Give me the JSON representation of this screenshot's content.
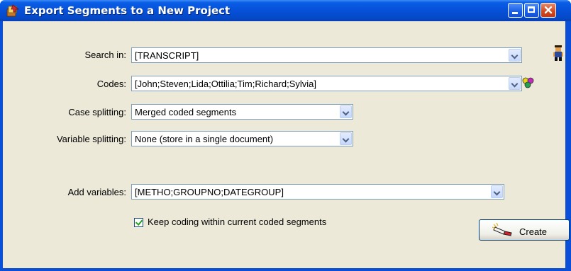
{
  "window": {
    "title": "Export Segments to a New Project",
    "title_icon": "export-project-icon"
  },
  "form": {
    "search_in": {
      "label": "Search in:",
      "value": "[TRANSCRIPT]"
    },
    "codes": {
      "label": "Codes:",
      "value": "[John;Steven;Lida;Ottilia;Tim;Richard;Sylvia]"
    },
    "case_splitting": {
      "label": "Case splitting:",
      "value": "Merged coded segments"
    },
    "variable_splitting": {
      "label": "Variable splitting:",
      "value": "None (store in a single document)"
    },
    "add_variables": {
      "label": "Add variables:",
      "value": "[METHO;GROUPNO;DATEGROUP]"
    },
    "keep_coding": {
      "label": "Keep coding within current coded segments",
      "checked": true
    }
  },
  "buttons": {
    "create": "Create"
  },
  "icons": {
    "help": "help-person-icon",
    "codes_selector": "colored-codes-icon",
    "create": "flashlight-icon"
  },
  "colors": {
    "title_bar": "#0a5ee6",
    "dialog_bg": "#ece9d8",
    "close_button": "#d2481e"
  }
}
